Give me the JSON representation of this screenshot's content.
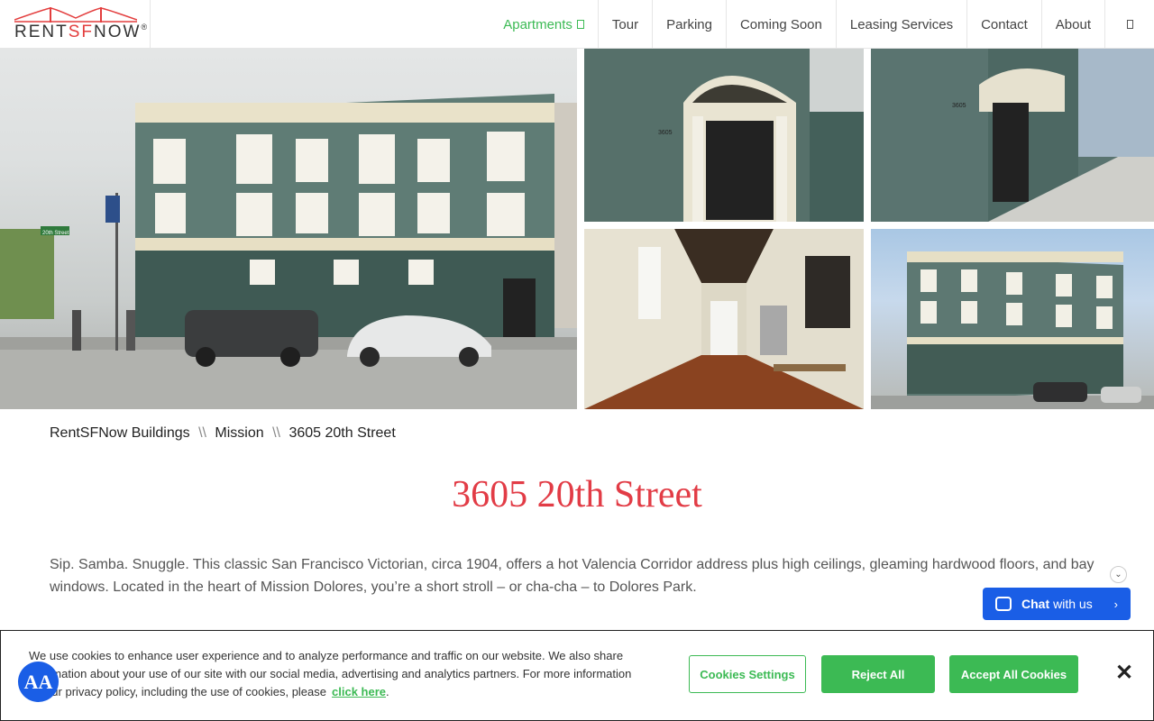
{
  "header": {
    "logo": {
      "part1": "RENT",
      "part2": "SF",
      "part3": "NOW",
      "mark": "®"
    },
    "nav": [
      {
        "label": "Apartments",
        "active": true
      },
      {
        "label": "Tour"
      },
      {
        "label": "Parking"
      },
      {
        "label": "Coming Soon"
      },
      {
        "label": "Leasing Services"
      },
      {
        "label": "Contact"
      },
      {
        "label": "About"
      }
    ]
  },
  "breadcrumb": {
    "item1": "RentSFNow Buildings",
    "sep1": "\\\\",
    "item2": "Mission",
    "sep2": "\\\\",
    "item3": "3605 20th Street"
  },
  "photo_text": {
    "street_sign": "20th Street",
    "address_number": "3605"
  },
  "page": {
    "title": "3605 20th Street",
    "description": "Sip. Samba. Snuggle. This classic San Francisco Victorian, circa 1904, offers a hot Valencia Corridor address plus high ceilings, gleaming hardwood floors, and bay windows. Located in the heart of Mission Dolores, you’re a short stroll – or cha-cha – to Dolores Park."
  },
  "chat": {
    "bold": "Chat",
    "rest": "with us"
  },
  "cookie": {
    "text": "We use cookies to enhance user experience and to analyze performance and traffic on our website. We also share information about your use of our site with our social media, advertising and analytics partners. For more information on our privacy policy, including the use of cookies, please",
    "link": "click here",
    "period": ".",
    "settings": "Cookies Settings",
    "reject": "Reject All",
    "accept": "Accept All Cookies"
  },
  "a11y": {
    "label": "AA"
  },
  "colors": {
    "accent": "#3cba54",
    "title": "#e23c46",
    "chat": "#1a5ee6"
  }
}
